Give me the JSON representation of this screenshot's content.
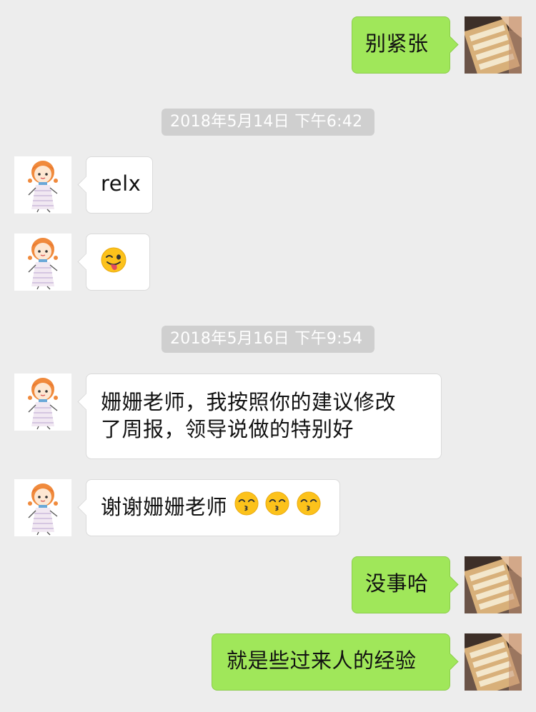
{
  "messages": [
    {
      "side": "out",
      "text": "别紧张"
    },
    {
      "type": "timestamp",
      "text": "2018年5月14日 下午6:42"
    },
    {
      "side": "in",
      "text": "relx"
    },
    {
      "side": "in",
      "emoji": "winking-tongue-emoji"
    },
    {
      "type": "timestamp",
      "text": "2018年5月16日 下午9:54"
    },
    {
      "side": "in",
      "text": "姗姗老师，我按照你的建议修改了周报，领导说做的特别好",
      "lines": [
        "姗姗老师，我按照你的建议修改",
        "了周报，领导说做的特别好"
      ]
    },
    {
      "side": "in",
      "text": "谢谢姗姗老师",
      "emojis": [
        "kissing-smiling-eyes-emoji",
        "kissing-smiling-eyes-emoji",
        "kissing-smiling-eyes-emoji"
      ]
    },
    {
      "side": "out",
      "text": "没事哈"
    },
    {
      "side": "out",
      "text": "就是些过来人的经验"
    }
  ],
  "colors": {
    "background": "#ededed",
    "outgoing_bubble": "#a0e75a",
    "incoming_bubble": "#ffffff",
    "timestamp_bg": "#cfcfcf"
  }
}
